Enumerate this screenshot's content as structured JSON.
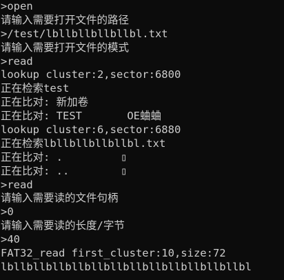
{
  "terminal": {
    "lines": [
      ">open",
      "请输入需要打开文件的路径",
      ">/test/lbllbllbllbllbl.txt",
      "请输入需要打开文件的模式",
      ">read",
      "lookup cluster:2,sector:6800",
      "正在检索test",
      "正在比对: 新加卷",
      "正在比对: TEST       OE蛐蛐",
      "lookup cluster:6,sector:6880",
      "正在检索lbllbllbllbllbl.txt",
      "正在比对: .         ▯",
      "正在比对: ..        ▯",
      ">read",
      "请输入需要读的文件句柄",
      ">0",
      "请输入需要读的长度/字节",
      ">40",
      "FAT32_read first_cluster:10,size:72",
      "lbllbllbllbllbllbllbllbllbllbllbllbllbl"
    ]
  },
  "colors": {
    "background": "#0c0c0c",
    "text": "#cccccc"
  }
}
